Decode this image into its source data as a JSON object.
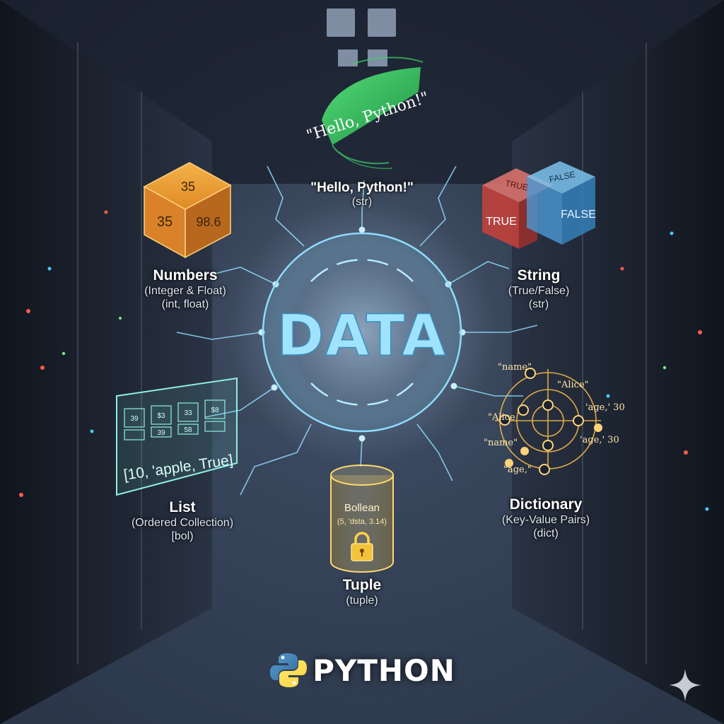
{
  "center": {
    "title": "DATA"
  },
  "string_ribbon": {
    "text": "\"Hello, Python!\""
  },
  "string_type": {
    "title": "\"Hello, Python!\"",
    "code": "(str)"
  },
  "numbers": {
    "cube_top": "35",
    "cube_left": "35",
    "cube_right": "98.6",
    "title": "Numbers",
    "desc": "(Integer & Float)",
    "code": "(int, float)"
  },
  "boolean": {
    "cube_true": "TRUE",
    "cube_false": "FALSE",
    "cube_top_true": "TRUE",
    "cube_top_false": "FALSE",
    "title": "String",
    "desc": "(True/False)",
    "code": "(str)"
  },
  "list": {
    "grid_cells": [
      "39",
      "$3",
      "33",
      "$8",
      "39",
      "58"
    ],
    "panel_text": "[10, 'apple, True]",
    "title": "List",
    "desc": "(Ordered Collection)",
    "code": "[bol)"
  },
  "tuple": {
    "cyl_title": "Bollean",
    "cyl_values": "(5, 'dsta, 3.14)",
    "title": "Tuple",
    "code": "(tuple)"
  },
  "dictionary": {
    "keys": [
      "\"name\"",
      "\"Alice\"",
      "\"Alice",
      "'age,' 30",
      "\"name\"",
      "'age,' 30",
      "\"age,\""
    ],
    "title": "Dictionary",
    "desc": "(Key-Value Pairs)",
    "code": "(dict)"
  },
  "brand": {
    "name": "PYTHON"
  },
  "colors": {
    "background": "#1a2230",
    "glow": "#7fd6ff",
    "number_cube": "#e6962c",
    "true_red": "#d9473f",
    "false_blue": "#4fa3e0",
    "string_green": "#3fd36a",
    "tuple_gold": "#f0c75a",
    "dict_gold": "#f2b84a",
    "python_blue": "#3a74b0",
    "python_yellow": "#f5c93a"
  }
}
